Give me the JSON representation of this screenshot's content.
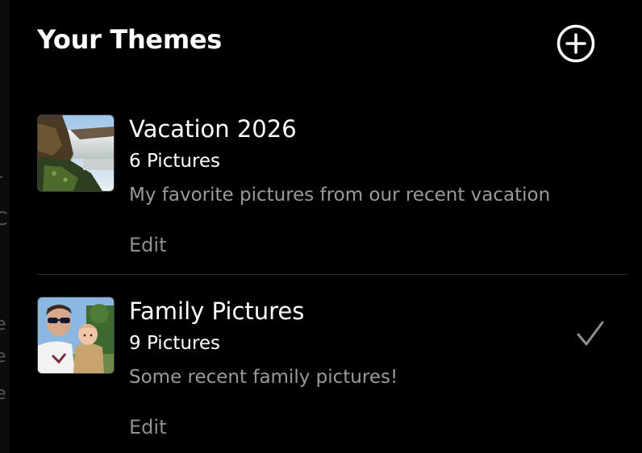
{
  "header": {
    "title": "Your Themes",
    "add_icon": "plus-circle-icon"
  },
  "themes": [
    {
      "name": "Vacation 2026",
      "count": "6 Pictures",
      "description": "My favorite pictures from our recent vacation",
      "edit_label": "Edit",
      "selected": false,
      "thumbnail": "waterfall-photo"
    },
    {
      "name": "Family Pictures",
      "count": "9 Pictures",
      "description": "Some recent family pictures!",
      "edit_label": "Edit",
      "selected": true,
      "thumbnail": "family-photo",
      "selected_icon": "checkmark-icon"
    }
  ],
  "colors": {
    "background": "#000000",
    "secondary_text": "#9a9a9e",
    "edit_text": "#8e8e93",
    "checkmark": "#8e8e93"
  }
}
